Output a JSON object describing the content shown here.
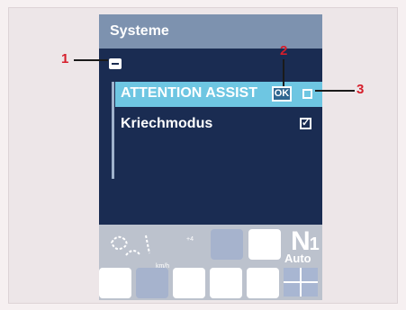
{
  "screen": {
    "title": "Systeme",
    "menu": {
      "back_icon": "back-icon",
      "items": [
        {
          "label": "ATTENTION ASSIST",
          "badge": "OK",
          "checked": false,
          "selected": true
        },
        {
          "label": "Kriechmodus",
          "checked": true,
          "selected": false
        }
      ]
    },
    "status": {
      "gear": "N",
      "gear_sub": "1",
      "transmission_mode": "Auto",
      "gauge_small_1": "+4",
      "gauge_small_2": "km/h"
    }
  },
  "callouts": [
    "1",
    "2",
    "3"
  ],
  "colors": {
    "screen_bg": "#1a2c52",
    "title_bar": "#7d92af",
    "highlight": "#6ec6e2",
    "callout": "#d61e2b"
  }
}
